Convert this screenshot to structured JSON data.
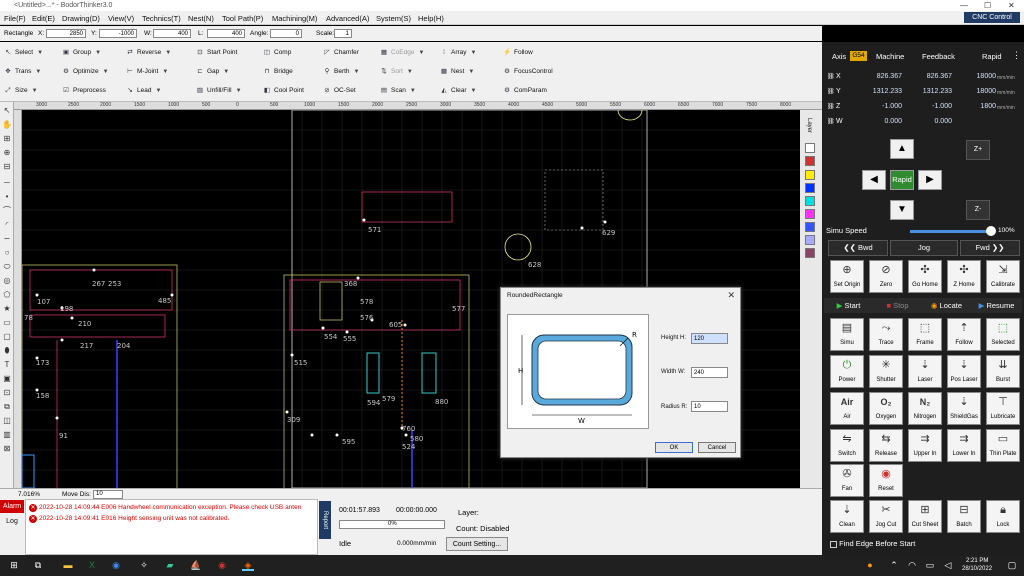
{
  "app": {
    "title": "<Untitled>...* - BodorThinker3.0",
    "min": "—",
    "max": "☐",
    "close": "✕"
  },
  "menu": [
    "File(F)",
    "Edit(E)",
    "Drawing(D)",
    "View(V)",
    "Technics(T)",
    "Nest(N)",
    "Tool Path(P)",
    "Machining(M)",
    "Advanced(A)",
    "System(S)",
    "Help(H)"
  ],
  "cnc_control": "CNC Control",
  "props": {
    "shape": "Rectangle",
    "x_label": "X:",
    "x": "2850",
    "y_label": "Y:",
    "y": "-1000",
    "w_label": "W:",
    "w": "400",
    "l_label": "L:",
    "l": "400",
    "angle_label": "Angle:",
    "angle": "0",
    "scale_label": "Scale:",
    "scale": "1"
  },
  "toolbar": [
    [
      "Select",
      "Trans",
      "Size"
    ],
    [
      "Group",
      "Optimize",
      "Preprocess"
    ],
    [
      "Reverse",
      "M-Joint",
      "Lead"
    ],
    [
      "Start Point",
      "Gap",
      "Unfill/Fill"
    ],
    [
      "Comp",
      "Bridge",
      "Cool Point"
    ],
    [
      "Chamfer",
      "Berth",
      "OC-Set"
    ],
    [
      "CoEdge",
      "Sort",
      "Scan"
    ],
    [
      "Array",
      "Nest",
      "Clear"
    ],
    [
      "Follow",
      "FocusControl",
      "ComParam"
    ]
  ],
  "ruler": [
    "3000",
    "2500",
    "2000",
    "1500",
    "1000",
    "500",
    "0",
    "500",
    "1000",
    "1500",
    "2000",
    "2500",
    "3000",
    "3500",
    "4000",
    "4500",
    "5000",
    "5500",
    "6000",
    "6500",
    "7000",
    "7500",
    "8000"
  ],
  "canvas_labels": [
    "571",
    "629",
    "628",
    "267",
    "253",
    "485",
    "107",
    "198",
    "210",
    "217",
    "204",
    "173",
    "158",
    "91",
    "368",
    "578",
    "576",
    "577",
    "554",
    "555",
    "515",
    "605",
    "594",
    "579",
    "880",
    "309",
    "595",
    "524",
    "760",
    "580",
    "78"
  ],
  "layer": {
    "label": "Layer"
  },
  "status": {
    "scale": "7.016%",
    "move_label": "Move Dis:",
    "move": "10"
  },
  "alarm": {
    "tab": "Alarm",
    "log": "Log",
    "msgs": [
      "2022-10-28 14:09:44  E006 Handwheel communication exception. Please check USB anten",
      "2022-10-28 14:09:41  E016 Height sensing unit was not calibrated."
    ],
    "report": "Report"
  },
  "run": {
    "elapsed": "00:01:57.893",
    "remain": "00:00:00.000",
    "progress": 0,
    "progress_text": "0%",
    "state": "Idle",
    "speed": "0.000mm/min",
    "layer_label": "Layer:",
    "count_label": "Count: Disabled",
    "count_setting": "Count Setting..."
  },
  "axis": {
    "axis_label": "Axis",
    "g": "G54",
    "machine": "Machine",
    "feedback": "Feedback",
    "rapid": "Rapid",
    "rows": [
      {
        "a": "X",
        "m": "826.367",
        "f": "826.367",
        "r": "18000",
        "u": "mm/min"
      },
      {
        "a": "Y",
        "m": "1312.233",
        "f": "1312.233",
        "r": "18000",
        "u": "mm/min"
      },
      {
        "a": "Z",
        "m": "-1.000",
        "f": "-1.000",
        "r": "1800",
        "u": "mm/min"
      },
      {
        "a": "W",
        "m": "0.000",
        "f": "0.000",
        "r": "",
        "u": ""
      }
    ]
  },
  "jog": {
    "up": "▲",
    "down": "▼",
    "left": "◀",
    "right": "▶",
    "center": "Rapid",
    "zplus": "Z+",
    "zminus": "Z-"
  },
  "simu": {
    "label": "Simu Speed",
    "value": "100%",
    "fraction": 1.0
  },
  "bjf": {
    "bwd": "Bwd",
    "jog": "Jog",
    "fwd": "Fwd"
  },
  "row1": [
    "Set Origin",
    "Zero",
    "Go Home",
    "Z Home",
    "Calibrate"
  ],
  "runbar": {
    "start": "Start",
    "stop": "Stop",
    "locate": "Locate",
    "resume": "Resume"
  },
  "grid": [
    [
      "Simu",
      "Trace",
      "Frame",
      "Follow",
      "Selected"
    ],
    [
      "Power",
      "Shutter",
      "Laser",
      "Pos Laser",
      "Burst"
    ],
    [
      "Air",
      "Oxygen",
      "Nitrogen",
      "ShieldGas",
      "Lubricate"
    ],
    [
      "Switch",
      "Release",
      "Upper In",
      "Lower In",
      "Thin Plate"
    ],
    [
      "Fan",
      "Reset",
      "",
      "",
      ""
    ],
    [
      "Clean",
      "Jog Cut",
      "Cut Sheet",
      "Batch",
      "Lock"
    ]
  ],
  "grid_icons": {
    "Air": "Air",
    "Oxygen": "O₂",
    "Nitrogen": "N₂"
  },
  "find_edge": "Find Edge Before Start",
  "dialog": {
    "title": "RoundedRectangle",
    "h_label": "Height H:",
    "h": "120",
    "w_label": "Width W:",
    "w": "240",
    "r_label": "Radius R:",
    "r": "10",
    "ok": "OK",
    "cancel": "Cancel",
    "dia_h": "H",
    "dia_w": "W",
    "dia_r": "R"
  },
  "taskbar": {
    "time": "2:21 PM",
    "date": "28/10/2022"
  }
}
